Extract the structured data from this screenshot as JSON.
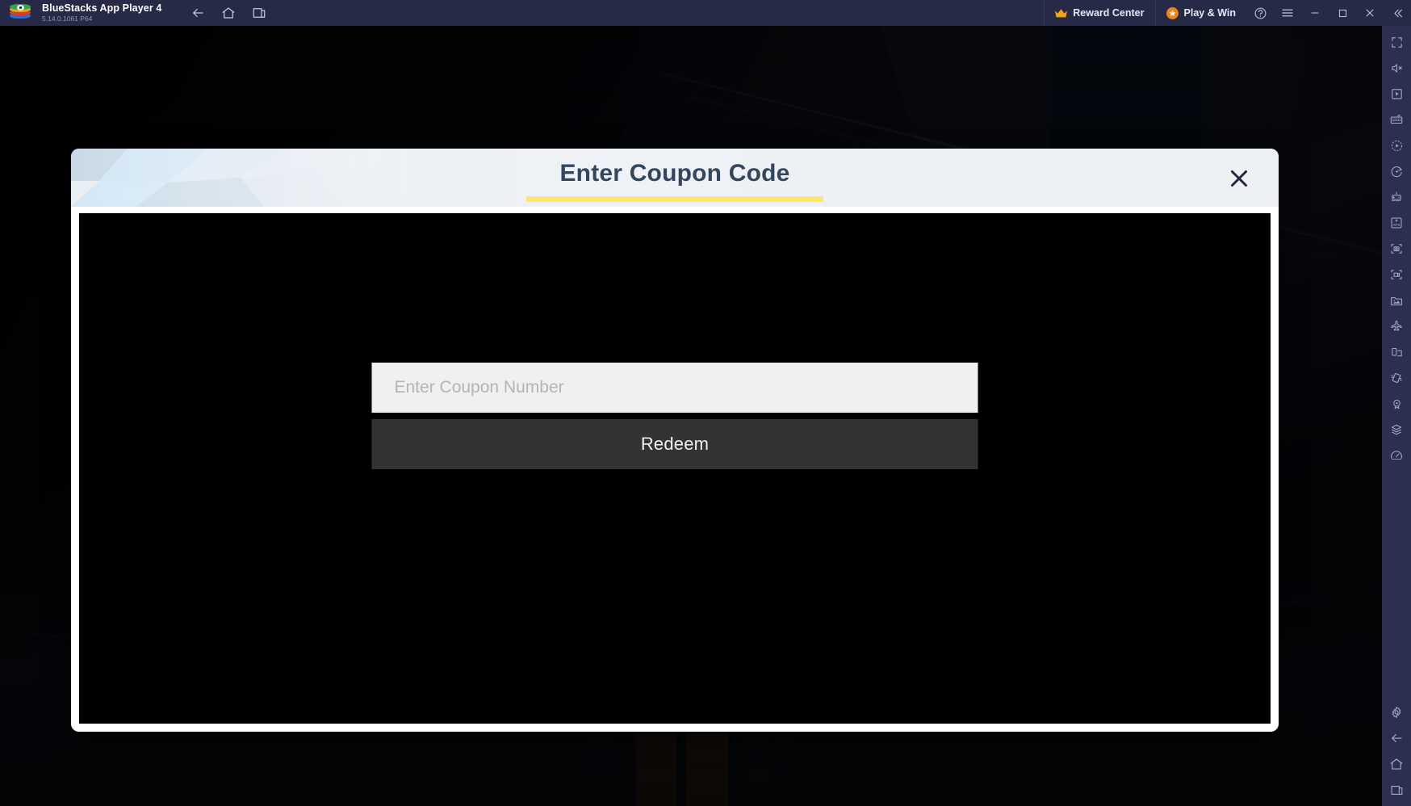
{
  "titlebar": {
    "app_name": "BlueStacks App Player 4",
    "version": "5.14.0.1061  P64",
    "logo_icon": "bluestacks-logo-icon",
    "nav": [
      {
        "name": "back",
        "icon": "arrow-left-icon",
        "label": ""
      },
      {
        "name": "home",
        "icon": "home-icon",
        "label": ""
      },
      {
        "name": "recents",
        "icon": "recent-apps-icon",
        "label": ""
      }
    ],
    "reward_center_label": "Reward Center",
    "reward_center_icon": "crown-icon",
    "play_win_label": "Play & Win",
    "play_win_icon": "orange-badge-icon",
    "help_icon": "help-circle-icon",
    "menu_icon": "hamburger-menu-icon",
    "minimize_icon": "minimize-icon",
    "maximize_icon": "maximize-icon",
    "close_icon": "close-icon",
    "collapse_icon": "double-chevron-left-icon"
  },
  "dialog": {
    "title": "Enter Coupon Code",
    "close_icon": "close-x-icon",
    "input_placeholder": "Enter Coupon Number",
    "input_value": "",
    "redeem_label": "Redeem"
  },
  "sidebar": {
    "items": [
      {
        "name": "fullscreen",
        "icon": "fullscreen-icon"
      },
      {
        "name": "mute",
        "icon": "speaker-mute-icon"
      },
      {
        "name": "cursor-control",
        "icon": "cursor-pointer-icon"
      },
      {
        "name": "keyboard-controls",
        "icon": "keyboard-icon"
      },
      {
        "name": "macro-recorder",
        "icon": "macro-play-icon"
      },
      {
        "name": "script-rotate",
        "icon": "rotate-dot-icon"
      },
      {
        "name": "game-controls",
        "icon": "gamepad-controls-icon"
      },
      {
        "name": "install-apk",
        "icon": "apk-install-icon"
      },
      {
        "name": "screenshot",
        "icon": "camera-screenshot-icon"
      },
      {
        "name": "record-screen",
        "icon": "video-record-icon"
      },
      {
        "name": "media-manager",
        "icon": "media-gallery-icon"
      },
      {
        "name": "eco-mode",
        "icon": "airplane-icon"
      },
      {
        "name": "multi-instance",
        "icon": "multi-window-icon"
      },
      {
        "name": "shake-tilt",
        "icon": "shake-device-icon"
      },
      {
        "name": "location",
        "icon": "location-pin-icon"
      },
      {
        "name": "instance-manager",
        "icon": "layers-stack-icon"
      },
      {
        "name": "performance",
        "icon": "speedometer-icon"
      }
    ],
    "bottom_items": [
      {
        "name": "settings",
        "icon": "gear-icon"
      },
      {
        "name": "android-back",
        "icon": "arrow-left-icon"
      },
      {
        "name": "android-home",
        "icon": "home-icon"
      },
      {
        "name": "android-recents",
        "icon": "recent-apps-icon"
      }
    ]
  },
  "colors": {
    "titlebar_bg": "#262a47",
    "sidebar_bg": "#2b2f50",
    "dialog_bg": "#ffffff",
    "dialog_header_bg": "#eef1f5",
    "title_text": "#33465f",
    "underline_yellow": "#f8e96e",
    "redeem_bg": "#333333",
    "input_bg": "#f0f0f0",
    "accent_orange": "#f08211",
    "crown_gold": "#f2a71b"
  }
}
